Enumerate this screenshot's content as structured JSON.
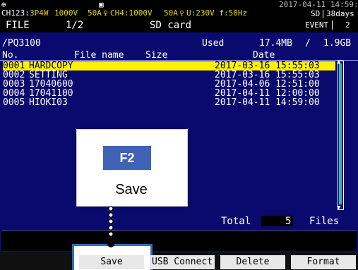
{
  "status": {
    "ch123": "CH123:",
    "wiring": "3P4W",
    "voltage_range": "1000V",
    "current1": "50A",
    "ch4": "CH4:1000V",
    "current2": "50A",
    "u": "U:230V f:50Hz",
    "datetime": "2017-04-11 14:59:18",
    "sd": "SD",
    "days": "38days",
    "event": "EVENT",
    "event_count": "2"
  },
  "header": {
    "file_label": "FILE",
    "page": "1/2",
    "title": "SD card"
  },
  "path": {
    "value": "/PQ3100",
    "used_label": "Used",
    "used": "17.4MB",
    "sep": "/",
    "capacity": "1.9GB"
  },
  "table": {
    "columns": [
      "No.",
      "File name",
      "Size",
      "Date"
    ],
    "rows": [
      {
        "no": "0001",
        "name": "HARDCOPY",
        "size": "",
        "date": "2017-03-16 15:55:03"
      },
      {
        "no": "0002",
        "name": "SETTING",
        "size": "",
        "date": "2017-03-16 15:55:03"
      },
      {
        "no": "0003",
        "name": "17040600",
        "size": "",
        "date": "2017-04-06 12:51:00"
      },
      {
        "no": "0004",
        "name": "17041100",
        "size": "",
        "date": "2017-04-11 12:00:00"
      },
      {
        "no": "0005",
        "name": "HIOKI03",
        "size": "",
        "date": "2017-04-11 14:59:00"
      }
    ]
  },
  "total": {
    "label": "Total",
    "count": "5",
    "unit": "Files"
  },
  "fkeys": [
    "Save",
    "USB Connect",
    "Delete",
    "Format"
  ],
  "callout": {
    "key": "F2",
    "label": "Save"
  },
  "colors": {
    "screen": "#0a0a6e",
    "selected_row": "#fff200",
    "callout_key": "#3f63b6",
    "highlight": "#2e6cc0"
  }
}
